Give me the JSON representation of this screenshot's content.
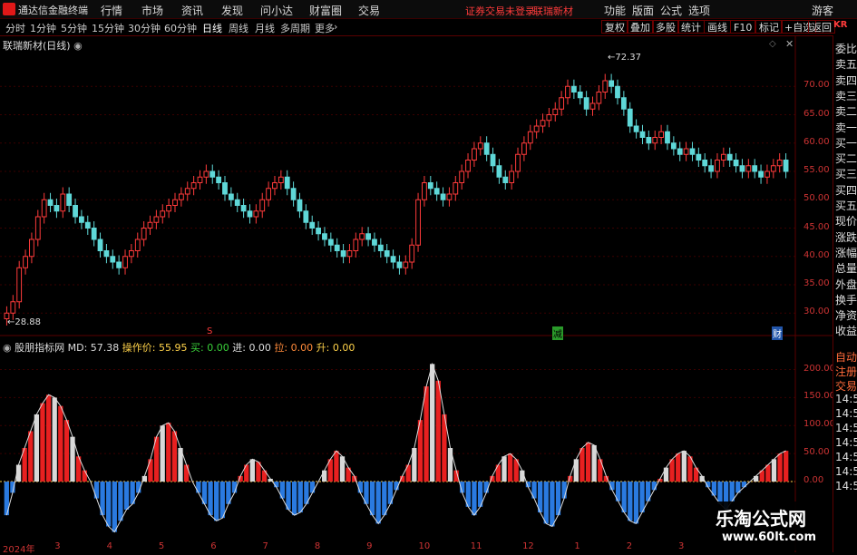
{
  "app": {
    "brand": "通达信金融终端",
    "menu": [
      "行情",
      "市场",
      "资讯",
      "发现",
      "问小达",
      "财富圈",
      "交易"
    ],
    "warning": "证券交易未登录",
    "stock_name": "联瑞新材",
    "right_menu": [
      "功能",
      "版面",
      "公式",
      "选项"
    ],
    "guest": "游客"
  },
  "toolbar": {
    "periods": [
      "分时",
      "1分钟",
      "5分钟",
      "15分钟",
      "30分钟",
      "60分钟",
      "日线",
      "周线",
      "月线",
      "多周期",
      "更多"
    ],
    "active": "日线",
    "buttons": [
      "复权",
      "叠加",
      "多股",
      "统计",
      "画线",
      "F10",
      "标记",
      "+自选",
      "返回"
    ]
  },
  "main_chart": {
    "title": "联瑞新材(日线)",
    "high_label": "72.37",
    "low_label": "28.88",
    "markers": [
      "S",
      "减",
      "财"
    ]
  },
  "indicator": {
    "name": "股朋指标网",
    "md_label": "MD:",
    "md_value": "57.38",
    "op_label": "操作价:",
    "op_value": "55.95",
    "buy_label": "买:",
    "buy_value": "0.00",
    "in_label": "进:",
    "in_value": "0.00",
    "pull_label": "拉:",
    "pull_value": "0.00",
    "up_label": "升:",
    "up_value": "0.00"
  },
  "right_panel": {
    "code": "KR",
    "items": [
      "委比",
      "卖五",
      "卖四",
      "卖三",
      "卖二",
      "卖一",
      "买一",
      "买二",
      "买三",
      "买四",
      "买五",
      "现价",
      "涨跌",
      "涨幅",
      "总量",
      "外盘",
      "换手",
      "净资",
      "收益",
      "自动",
      "注册",
      "交易",
      "14:5",
      "14:5",
      "14:5",
      "14:5",
      "14:5",
      "14:5",
      "14:5"
    ]
  },
  "chart_data": [
    {
      "type": "candlestick",
      "ylim": [
        27,
        75
      ],
      "yticks": [
        "70.00",
        "65.00",
        "60.00",
        "55.00",
        "50.00",
        "45.00",
        "40.00",
        "35.00",
        "30.00"
      ],
      "closes": [
        30,
        32,
        38,
        40,
        43,
        47,
        50,
        49,
        48,
        51,
        49,
        47,
        46,
        45,
        43,
        41,
        40,
        39,
        38,
        40,
        41,
        43,
        45,
        46,
        47,
        48,
        49,
        50,
        51,
        52,
        53,
        54,
        55,
        54,
        53,
        51,
        50,
        49,
        48,
        47,
        48,
        50,
        52,
        53,
        54,
        52,
        50,
        48,
        46,
        45,
        44,
        43,
        42,
        41,
        40,
        41,
        43,
        44,
        43,
        42,
        41,
        40,
        39,
        38,
        39,
        42,
        50,
        53,
        52,
        51,
        50,
        51,
        53,
        55,
        57,
        59,
        60,
        58,
        56,
        54,
        53,
        55,
        58,
        60,
        62,
        63,
        64,
        65,
        66,
        68,
        70,
        69,
        68,
        66,
        67,
        69,
        71,
        70,
        68,
        66,
        63,
        62,
        61,
        60,
        61,
        62,
        60,
        59,
        58,
        59,
        58,
        57,
        56,
        55,
        57,
        58,
        57,
        56,
        55,
        56,
        55,
        54,
        55,
        56,
        57,
        55
      ]
    },
    {
      "type": "bar",
      "ylim": [
        -110,
        230
      ],
      "yticks": [
        "200.00",
        "150.00",
        "100.00",
        "50.00",
        "0.00"
      ],
      "x": [
        "2024年",
        "3",
        "4",
        "5",
        "6",
        "7",
        "8",
        "9",
        "10",
        "11",
        "12",
        "1",
        "2",
        "3"
      ],
      "values": [
        -60,
        -20,
        30,
        60,
        90,
        120,
        140,
        155,
        150,
        135,
        110,
        80,
        45,
        20,
        0,
        -30,
        -60,
        -80,
        -90,
        -70,
        -50,
        -40,
        -20,
        10,
        40,
        80,
        100,
        105,
        90,
        60,
        30,
        0,
        -20,
        -40,
        -60,
        -70,
        -65,
        -40,
        -20,
        10,
        30,
        40,
        35,
        20,
        5,
        -10,
        -30,
        -50,
        -60,
        -55,
        -40,
        -20,
        0,
        20,
        40,
        55,
        45,
        25,
        10,
        -20,
        -40,
        -60,
        -75,
        -60,
        -40,
        -15,
        10,
        30,
        60,
        110,
        170,
        210,
        180,
        120,
        60,
        20,
        -20,
        -45,
        -60,
        -45,
        -20,
        10,
        30,
        45,
        50,
        40,
        20,
        -10,
        -30,
        -55,
        -75,
        -80,
        -60,
        -30,
        10,
        40,
        60,
        70,
        65,
        40,
        10,
        -15,
        -35,
        -55,
        -70,
        -75,
        -55,
        -35,
        -15,
        5,
        25,
        40,
        50,
        55,
        45,
        25,
        10,
        -10,
        -25,
        -40,
        -50,
        -35,
        -20,
        -10,
        0,
        10,
        20,
        30,
        40,
        50,
        55
      ]
    }
  ],
  "watermark": {
    "line1": "乐淘公式网",
    "line2": "www.60lt.com"
  }
}
